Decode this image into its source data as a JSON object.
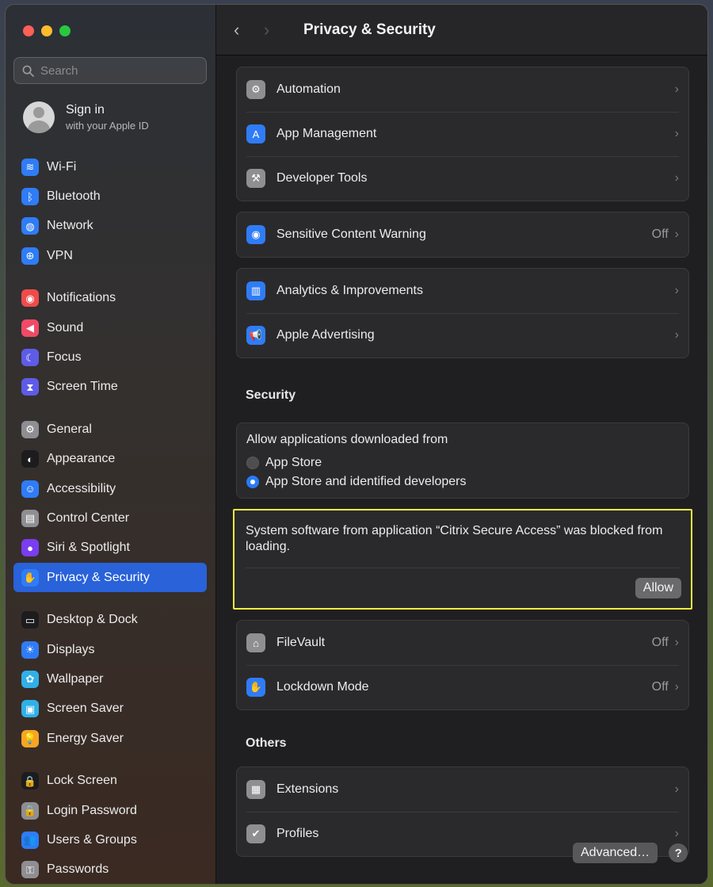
{
  "window": {
    "title": "Privacy & Security"
  },
  "sidebar": {
    "search_placeholder": "Search",
    "account": {
      "title": "Sign in",
      "subtitle": "with your Apple ID"
    },
    "groups": [
      [
        {
          "label": "Wi-Fi",
          "icon": "wifi-icon",
          "color": "#2f7cf6",
          "glyph": "≋"
        },
        {
          "label": "Bluetooth",
          "icon": "bluetooth-icon",
          "color": "#2f7cf6",
          "glyph": "ᛒ"
        },
        {
          "label": "Network",
          "icon": "network-icon",
          "color": "#2f7cf6",
          "glyph": "◍"
        },
        {
          "label": "VPN",
          "icon": "vpn-icon",
          "color": "#2f7cf6",
          "glyph": "⊕"
        }
      ],
      [
        {
          "label": "Notifications",
          "icon": "notifications-icon",
          "color": "#ef4b4b",
          "glyph": "◉"
        },
        {
          "label": "Sound",
          "icon": "sound-icon",
          "color": "#ef4b66",
          "glyph": "◀"
        },
        {
          "label": "Focus",
          "icon": "focus-icon",
          "color": "#5e5ce6",
          "glyph": "☾"
        },
        {
          "label": "Screen Time",
          "icon": "screen-time-icon",
          "color": "#5e5ce6",
          "glyph": "⧗"
        }
      ],
      [
        {
          "label": "General",
          "icon": "gear-icon",
          "color": "#8e8e93",
          "glyph": "⚙"
        },
        {
          "label": "Appearance",
          "icon": "appearance-icon",
          "color": "#1c1c1e",
          "glyph": "◐"
        },
        {
          "label": "Accessibility",
          "icon": "accessibility-icon",
          "color": "#2f7cf6",
          "glyph": "☺"
        },
        {
          "label": "Control Center",
          "icon": "control-center-icon",
          "color": "#8e8e93",
          "glyph": "▤"
        },
        {
          "label": "Siri & Spotlight",
          "icon": "siri-icon",
          "color": "#7a3df0",
          "glyph": "●"
        },
        {
          "label": "Privacy & Security",
          "icon": "hand-icon",
          "color": "#2f7cf6",
          "glyph": "✋",
          "active": true
        }
      ],
      [
        {
          "label": "Desktop & Dock",
          "icon": "desktop-dock-icon",
          "color": "#1c1c1e",
          "glyph": "▭"
        },
        {
          "label": "Displays",
          "icon": "displays-icon",
          "color": "#2f7cf6",
          "glyph": "☀"
        },
        {
          "label": "Wallpaper",
          "icon": "wallpaper-icon",
          "color": "#30b0e8",
          "glyph": "✿"
        },
        {
          "label": "Screen Saver",
          "icon": "screen-saver-icon",
          "color": "#30b0e8",
          "glyph": "▣"
        },
        {
          "label": "Energy Saver",
          "icon": "energy-saver-icon",
          "color": "#f6a623",
          "glyph": "💡"
        }
      ],
      [
        {
          "label": "Lock Screen",
          "icon": "lock-icon",
          "color": "#1c1c1e",
          "glyph": "🔒"
        },
        {
          "label": "Login Password",
          "icon": "login-password-icon",
          "color": "#8e8e93",
          "glyph": "🔒"
        },
        {
          "label": "Users & Groups",
          "icon": "users-icon",
          "color": "#2f7cf6",
          "glyph": "👥"
        },
        {
          "label": "Passwords",
          "icon": "key-icon",
          "color": "#8e8e93",
          "glyph": "⚿"
        }
      ]
    ]
  },
  "main": {
    "group1": [
      {
        "label": "Automation",
        "icon": "automation-icon",
        "color": "#8e8e93",
        "glyph": "⚙"
      },
      {
        "label": "App Management",
        "icon": "app-store-icon",
        "color": "#2f7cf6",
        "glyph": "A"
      },
      {
        "label": "Developer Tools",
        "icon": "hammer-icon",
        "color": "#8e8e93",
        "glyph": "⚒"
      }
    ],
    "group2": [
      {
        "label": "Sensitive Content Warning",
        "icon": "eye-icon",
        "color": "#2f7cf6",
        "glyph": "◉",
        "value": "Off"
      }
    ],
    "group3": [
      {
        "label": "Analytics & Improvements",
        "icon": "analytics-icon",
        "color": "#2f7cf6",
        "glyph": "▥"
      },
      {
        "label": "Apple Advertising",
        "icon": "megaphone-icon",
        "color": "#2f7cf6",
        "glyph": "📢"
      }
    ],
    "security_heading": "Security",
    "allow_apps": {
      "heading": "Allow applications downloaded from",
      "option1": "App Store",
      "option2": "App Store and identified developers"
    },
    "blocked": {
      "message": "System software from application “Citrix Secure Access” was blocked from loading.",
      "button": "Allow"
    },
    "group4": [
      {
        "label": "FileVault",
        "icon": "filevault-icon",
        "color": "#8e8e93",
        "glyph": "⌂",
        "value": "Off"
      },
      {
        "label": "Lockdown Mode",
        "icon": "hand-icon",
        "color": "#2f7cf6",
        "glyph": "✋",
        "value": "Off"
      }
    ],
    "others_heading": "Others",
    "group5": [
      {
        "label": "Extensions",
        "icon": "extensions-icon",
        "color": "#8e8e93",
        "glyph": "▦"
      },
      {
        "label": "Profiles",
        "icon": "checkmark-shield-icon",
        "color": "#8e8e93",
        "glyph": "✔"
      }
    ],
    "advanced_button": "Advanced…",
    "help_button": "?"
  }
}
